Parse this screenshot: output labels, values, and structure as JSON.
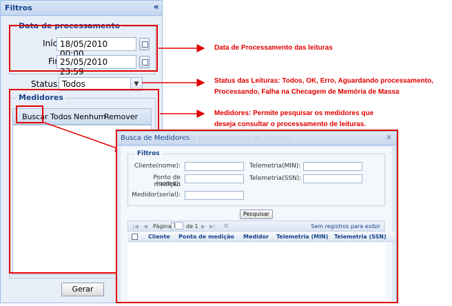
{
  "panel": {
    "title": "Filtros",
    "collapse_glyph": "«",
    "date_group": {
      "legend": "Data de processamento",
      "start_label": "Início:",
      "start_value": "18/05/2010 00:00",
      "end_label": "Fim:",
      "end_value": "25/05/2010 23:59"
    },
    "status": {
      "label": "Status:",
      "value": "Todos",
      "arrow": "▼"
    },
    "meters": {
      "legend": "Medidores",
      "buttons": {
        "search": "Buscar",
        "all": "Todos",
        "none": "Nenhum",
        "remove": "Remover"
      }
    },
    "generate_button": "Gerar"
  },
  "annotations": {
    "date": "Data de Processamento das leituras",
    "status_line1": "Status das Leituras: Todos, OK, Erro, Aguardando processamento,",
    "status_line2": "Processando, Falha na Checagem de Memória de Massa",
    "meters_line1": "Medidores: Permite pesquisar os medidores que",
    "meters_line2": "deseja consultar o processamento de leituras."
  },
  "search_window": {
    "title": "Busca de Medidores",
    "ghost_title": "to de processamento de leituras",
    "close_glyph": "✕",
    "filters_legend": "Filtros",
    "fields": {
      "client": "Cliente(nome):",
      "point_line1": "Ponto de medição",
      "point_line2": "(nome):",
      "meter_serial": "Medidor(serial):",
      "telemetry_min": "Telemetria(MIN):",
      "telemetry_ssn": "Telemetria(SSN):"
    },
    "search_button": "Pesquisar",
    "pager": {
      "first": "|◀",
      "prev": "◀",
      "page_label": "Página",
      "page_value": "1",
      "of_label": "de 1",
      "next": "▶",
      "last": "▶|",
      "refresh": "✲",
      "empty_text": "Sem registros para exibir"
    },
    "columns": [
      "Cliente",
      "Ponto de medição",
      "Medidor",
      "Telemetria (MIN)",
      "Telemetria (SSN)"
    ]
  },
  "colors": {
    "annotation_red": "#e10000",
    "header_blue": "#15428b"
  }
}
